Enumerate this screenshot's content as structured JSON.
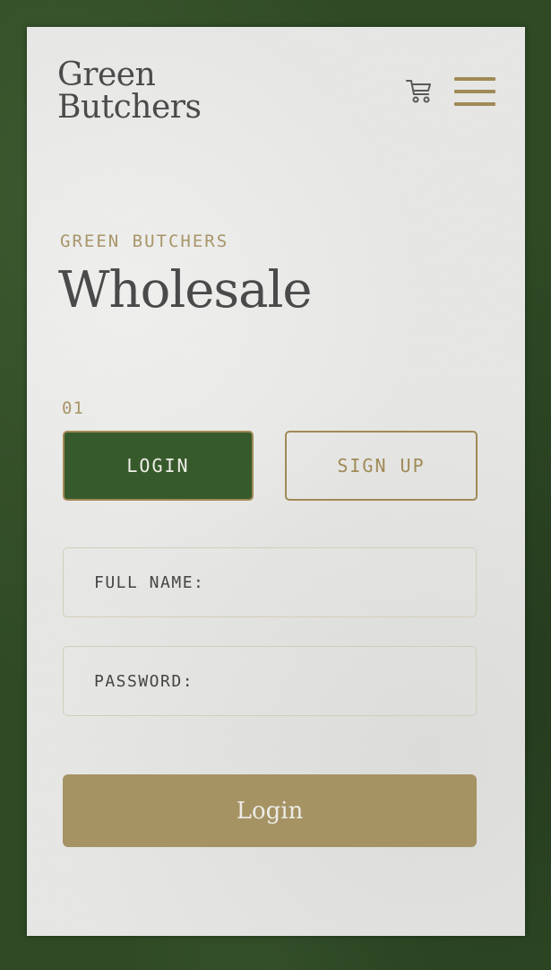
{
  "brand": {
    "line1": "Green",
    "line2": "Butchers"
  },
  "header": {
    "cart_icon": "cart-icon",
    "menu_icon": "hamburger-menu-icon"
  },
  "hero": {
    "eyebrow": "GREEN BUTCHERS",
    "title": "Wholesale"
  },
  "step": {
    "number": "01"
  },
  "tabs": [
    {
      "label": "LOGIN",
      "active": true
    },
    {
      "label": "SIGN UP",
      "active": false
    }
  ],
  "form": {
    "full_name_label": "FULL NAME:",
    "password_label": "PASSWORD:",
    "submit_label": "Login"
  },
  "colors": {
    "background_green": "#2f4a25",
    "paper": "#e7e7e5",
    "accent_gold": "#a08a56",
    "active_tab_green": "#375a2c",
    "submit_button": "#a69364",
    "text_dark": "#4a4a4a"
  }
}
